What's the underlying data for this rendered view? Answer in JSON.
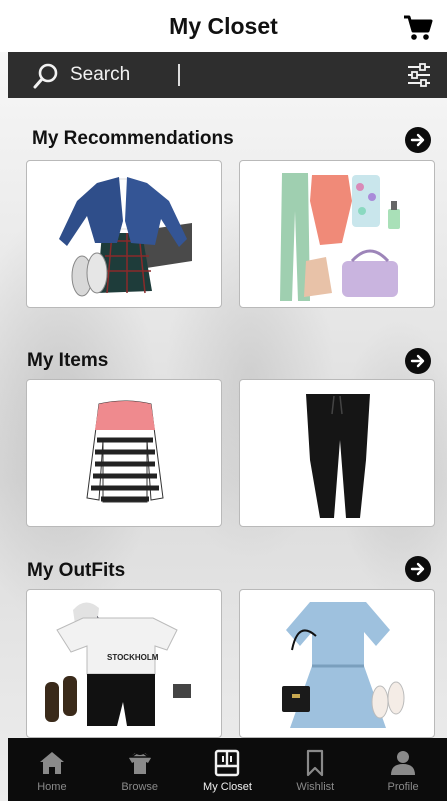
{
  "header": {
    "title": "My Closet",
    "cart_icon": "shopping-cart-icon"
  },
  "search": {
    "placeholder": "Search",
    "filter_icon": "sliders-icon"
  },
  "sections": [
    {
      "title": "My Recommendations",
      "items": [
        "denim-jacket-outfit",
        "pastel-outfit"
      ]
    },
    {
      "title": "My Items",
      "items": [
        "striped-sweater",
        "black-joggers"
      ]
    },
    {
      "title": "My OutFits",
      "items": [
        "stockholm-tee-outfit",
        "blue-sweater-dress-outfit"
      ]
    }
  ],
  "outfit_text": "STOCKHOLM",
  "nav": {
    "items": [
      {
        "label": "Home",
        "icon": "home-icon"
      },
      {
        "label": "Browse",
        "icon": "browse-shirt-icon"
      },
      {
        "label": "My Closet",
        "icon": "closet-icon"
      },
      {
        "label": "Wishlist",
        "icon": "bookmark-icon"
      },
      {
        "label": "Profile",
        "icon": "person-icon"
      }
    ],
    "active": "My Closet"
  },
  "colors": {
    "accent_dark": "#0c0c0c",
    "searchbar": "#2e2e2e",
    "nav_inactive": "#8a8a8a",
    "nav_active": "#f0f0f0"
  }
}
